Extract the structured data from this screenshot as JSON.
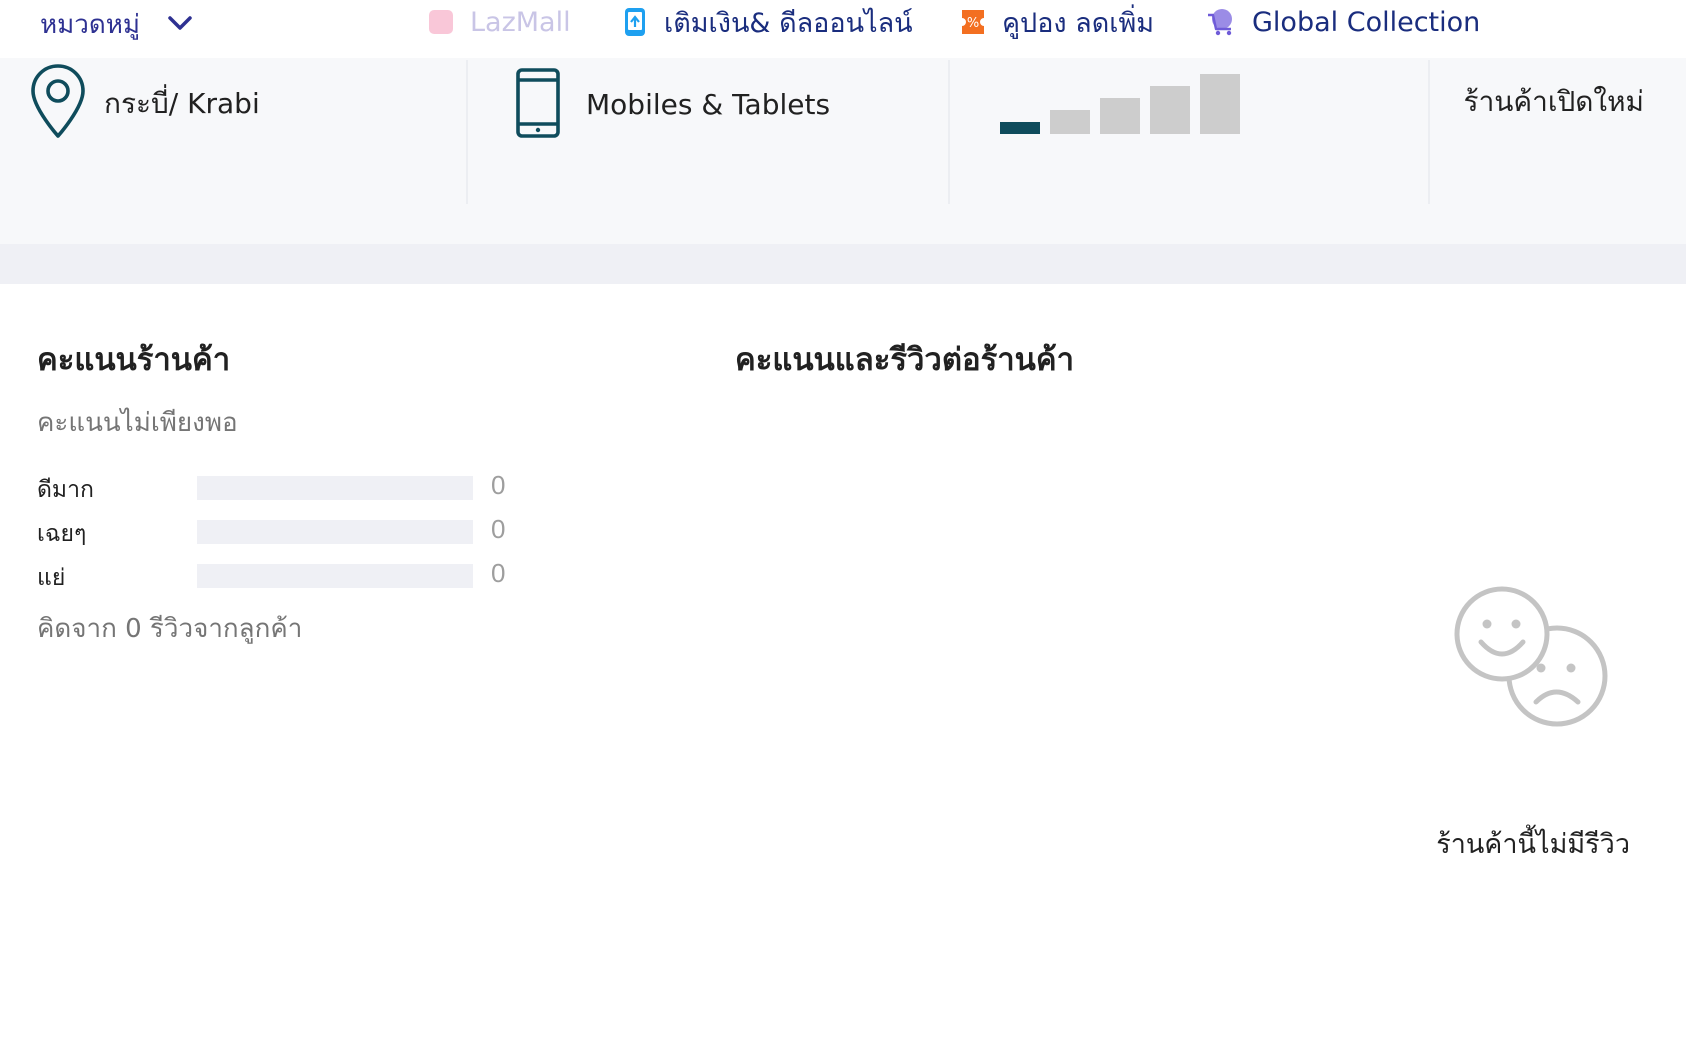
{
  "nav": {
    "category_menu": {
      "label": "หมวดหมู่",
      "icon": "chevron-down-icon"
    },
    "links": [
      {
        "label": "LazMall",
        "icon": "lazmall-icon"
      },
      {
        "label": "เติมเงิน& ดีลออนไลน์",
        "icon": "topup-phone-icon"
      },
      {
        "label": "คูปอง ลดเพิ่ม",
        "icon": "coupon-icon"
      },
      {
        "label": "Global Collection",
        "icon": "global-cart-icon"
      }
    ]
  },
  "store_info": {
    "location": {
      "text": "กระบี่/ Krabi",
      "icon": "location-pin-icon"
    },
    "category": {
      "text": "Mobiles & Tablets",
      "icon": "mobile-phone-icon"
    },
    "seller_level": {
      "level": 1,
      "max": 5,
      "icon": "signal-bars-icon"
    },
    "badge": "ร้านค้าเปิดใหม่"
  },
  "rating": {
    "title": "คะแนนร้านค้า",
    "status": "คะแนนไม่เพียงพอ",
    "rows": [
      {
        "label": "ดีมาก",
        "count": "0",
        "fraction": 0
      },
      {
        "label": "เฉยๆ",
        "count": "0",
        "fraction": 0
      },
      {
        "label": "แย่",
        "count": "0",
        "fraction": 0
      }
    ],
    "basis": "คิดจาก 0 รีวิวจากลูกค้า"
  },
  "reviews": {
    "title": "คะแนนและรีวิวต่อร้านค้า",
    "empty_icon": "happy-sad-faces-icon",
    "empty_text": "ร้านค้านี้ไม่มีรีวิว"
  },
  "colors": {
    "nav_text": "#1a2d7e",
    "accent_dark": "#0f4c5c",
    "muted": "#757575"
  }
}
